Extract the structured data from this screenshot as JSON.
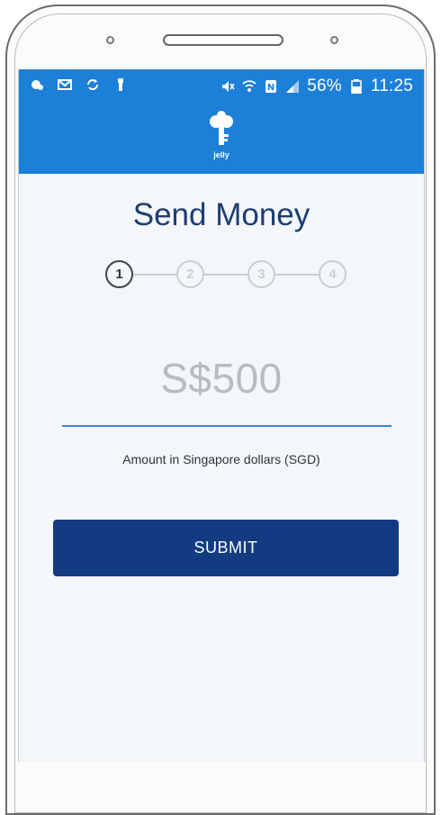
{
  "statusbar": {
    "battery": "56%",
    "time": "11:25",
    "left_icons": [
      "notification-icon",
      "mail-icon",
      "sync-icon",
      "usb-icon"
    ],
    "right_icons": [
      "mute-icon",
      "wifi-icon",
      "nfc-icon",
      "signal-icon",
      "battery-icon"
    ]
  },
  "header": {
    "logo_icon": "jelly-key-icon",
    "logo_text": "jelly"
  },
  "main": {
    "title": "Send Money",
    "steps": [
      {
        "label": "1",
        "active": true
      },
      {
        "label": "2",
        "active": false
      },
      {
        "label": "3",
        "active": false
      },
      {
        "label": "4",
        "active": false
      }
    ],
    "amount_placeholder": "S$500",
    "amount_hint": "Amount in Singapore dollars (SGD)",
    "submit_label": "SUBMIT"
  },
  "colors": {
    "appbar": "#1c7fd8",
    "title": "#1e3d74",
    "submit": "#133b81",
    "underline": "#2e8ad8"
  }
}
